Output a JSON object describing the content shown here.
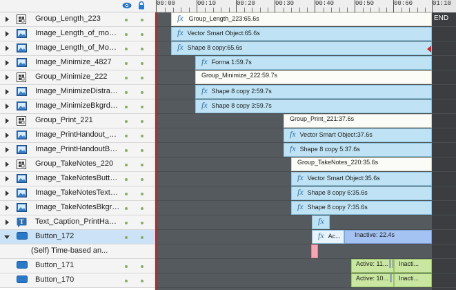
{
  "header": {
    "visibility_icon": "eye-icon",
    "lock_icon": "lock-icon"
  },
  "ruler": {
    "labels": [
      "00:00",
      "00:10",
      "00:20",
      "00:30",
      "00:40",
      "00:50",
      "00:60",
      "01:10"
    ],
    "end_label": "END"
  },
  "rows": [
    {
      "name": "Group_Length_223",
      "icon": "group-icon",
      "expandable": true
    },
    {
      "name": "Image_Length_of_modul...",
      "icon": "image-icon",
      "expandable": true
    },
    {
      "name": "Image_Length_of_Modul...",
      "icon": "image-icon",
      "expandable": true
    },
    {
      "name": "Image_Minimize_4827",
      "icon": "image-icon",
      "expandable": true
    },
    {
      "name": "Group_Minimize_222",
      "icon": "group-icon",
      "expandable": true
    },
    {
      "name": "Image_MinimizeDistracti...",
      "icon": "image-icon",
      "expandable": true
    },
    {
      "name": "Image_MinimizeBkgrd_48...",
      "icon": "image-icon",
      "expandable": true
    },
    {
      "name": "Group_Print_221",
      "icon": "group-icon",
      "expandable": true
    },
    {
      "name": "Image_PrintHandout_4824",
      "icon": "image-icon",
      "expandable": true
    },
    {
      "name": "Image_PrintHandoutBkgr...",
      "icon": "image-icon",
      "expandable": true
    },
    {
      "name": "Group_TakeNotes_220",
      "icon": "group-icon",
      "expandable": true
    },
    {
      "name": "Image_TakeNotesButton...",
      "icon": "image-icon",
      "expandable": true
    },
    {
      "name": "Image_TakeNotesText_4...",
      "icon": "image-icon",
      "expandable": true
    },
    {
      "name": "Image_TakeNotesBkgrd_...",
      "icon": "image-icon",
      "expandable": true
    },
    {
      "name": "Text_Caption_PrintHando...",
      "icon": "text-caption-icon",
      "expandable": true
    },
    {
      "name": "Button_172",
      "icon": "button-icon",
      "expandable": true,
      "expanded": true,
      "selected": true
    },
    {
      "name": "(Self) Time-based an...",
      "icon": "",
      "expandable": false,
      "child": true
    },
    {
      "name": "Button_171",
      "icon": "button-icon",
      "expandable": false,
      "child": true
    },
    {
      "name": "Button_170",
      "icon": "button-icon",
      "expandable": false,
      "child": true
    }
  ],
  "bars": [
    {
      "row": 0,
      "fx": true,
      "label": "Group_Length_223:65.6s",
      "kind": "group"
    },
    {
      "row": 1,
      "fx": true,
      "label": "Vector Smart Object:65.6s",
      "kind": "object"
    },
    {
      "row": 2,
      "fx": true,
      "label": "Shape 8 copy:65.6s",
      "kind": "object"
    },
    {
      "row": 3,
      "fx": true,
      "label": "Forma 1:59.7s",
      "kind": "object"
    },
    {
      "row": 4,
      "fx": false,
      "label": "Group_Minimize_222:59.7s",
      "kind": "group"
    },
    {
      "row": 5,
      "fx": true,
      "label": "Shape 8 copy 2:59.7s",
      "kind": "object"
    },
    {
      "row": 6,
      "fx": true,
      "label": "Shape 8 copy 3:59.7s",
      "kind": "object"
    },
    {
      "row": 7,
      "fx": false,
      "label": "Group_Print_221:37.6s",
      "kind": "group"
    },
    {
      "row": 8,
      "fx": true,
      "label": "Vector Smart Object:37.6s",
      "kind": "object"
    },
    {
      "row": 9,
      "fx": true,
      "label": "Shape 8 copy 5:37.6s",
      "kind": "object"
    },
    {
      "row": 10,
      "fx": false,
      "label": "Group_TakeNotes_220:35.6s",
      "kind": "group"
    },
    {
      "row": 11,
      "fx": true,
      "label": "Vector Smart Object:35.6s",
      "kind": "object"
    },
    {
      "row": 12,
      "fx": true,
      "label": "Shape 8 copy 6:35.6s",
      "kind": "object"
    },
    {
      "row": 13,
      "fx": true,
      "label": "Shape 8 copy 7:35.6s",
      "kind": "object"
    },
    {
      "row": 14,
      "fx": true,
      "label": "",
      "kind": "object"
    },
    {
      "row": 15,
      "fx": true,
      "label": "Ac...",
      "kind": "object",
      "inactive_label": "Inactive: 22.4s"
    },
    {
      "row": 16,
      "fx": false,
      "label": "",
      "kind": "pink"
    },
    {
      "row": 17,
      "fx": false,
      "label": "Active: 11...",
      "kind": "active",
      "inactive_label": "Inacti..."
    },
    {
      "row": 18,
      "fx": false,
      "label": "Active: 10...",
      "kind": "active",
      "inactive_label": "Inacti..."
    }
  ],
  "colors": {
    "bar_object": "#bfe3f5",
    "bar_group": "#fbfbf7",
    "bar_inactive": "#a5c3f2",
    "bar_active": "#c9e7a1",
    "playhead": "#d01818",
    "track_bg": "#555a5f"
  }
}
